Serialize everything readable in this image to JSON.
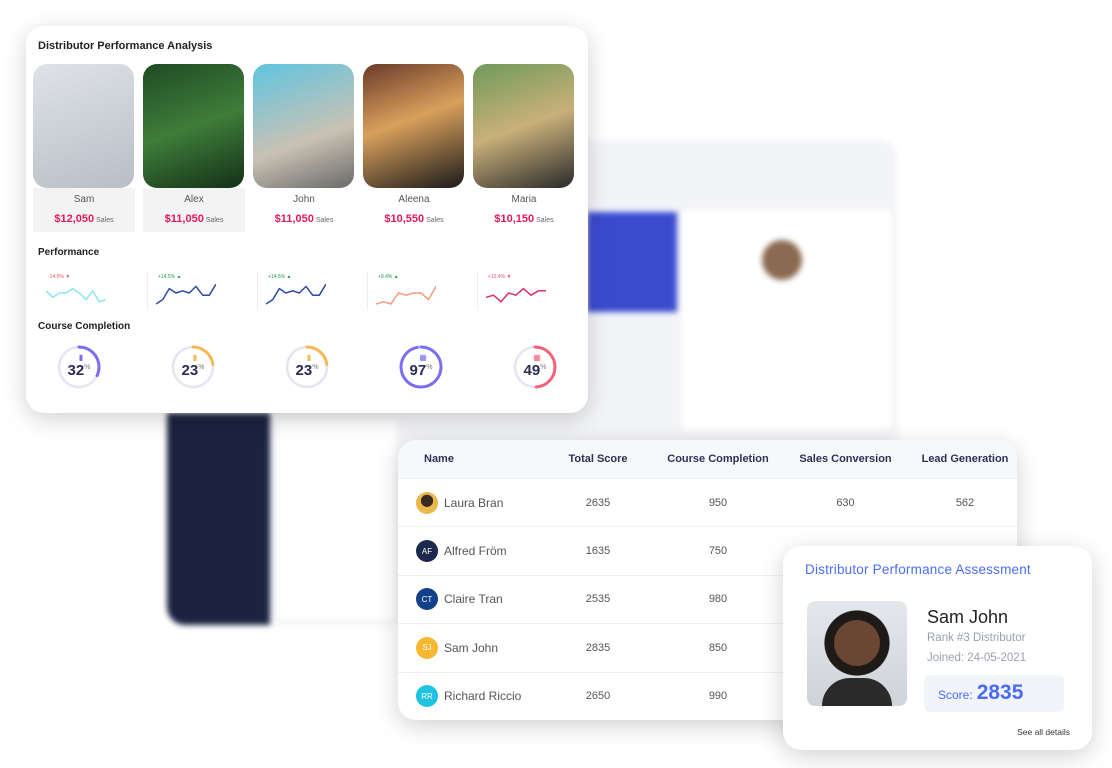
{
  "analysis": {
    "title": "Distributor Performance Analysis",
    "people": [
      {
        "name": "Sam",
        "sales": "$12,050",
        "unit": "Sales",
        "photo": "linear-gradient(160deg,#dfe3e8,#b8bec6)"
      },
      {
        "name": "Alex",
        "sales": "$11,050",
        "unit": "Sales",
        "photo": "linear-gradient(160deg,#1f4a24,#3f7d3a 50%,#143018)"
      },
      {
        "name": "John",
        "sales": "$11,050",
        "unit": "Sales",
        "photo": "linear-gradient(160deg,#5fc4e0,#c9c2b4 60%,#6a6a6a)"
      },
      {
        "name": "Aleena",
        "sales": "$10,550",
        "unit": "Sales",
        "photo": "linear-gradient(160deg,#6a3a2a,#d9a05c 45%,#1a1a1a)"
      },
      {
        "name": "Maria",
        "sales": "$10,150",
        "unit": "Sales",
        "photo": "linear-gradient(160deg,#6f9a5a,#c9b07a 50%,#2a2a2a)"
      }
    ],
    "performance_title": "Performance",
    "sparklines": [
      {
        "label": "-14.5% ▼",
        "label_color": "#e0556a",
        "color": "#8be3f0",
        "shape": [
          6,
          3,
          5,
          5,
          7,
          5,
          2,
          6,
          1,
          2
        ]
      },
      {
        "label": "+14.5% ▲",
        "label_color": "#1a9a4a",
        "color": "#2b4aa8",
        "shape": [
          0,
          2,
          7,
          5,
          6,
          5,
          8,
          4,
          4,
          9
        ]
      },
      {
        "label": "+14.5% ▲",
        "label_color": "#1a9a4a",
        "color": "#2b4aa8",
        "shape": [
          0,
          2,
          7,
          5,
          6,
          5,
          8,
          4,
          4,
          9
        ]
      },
      {
        "label": "+9.4% ▲",
        "label_color": "#1a9a4a",
        "color": "#f49a7a",
        "shape": [
          0,
          1,
          0,
          5,
          4,
          5,
          5,
          2,
          8
        ]
      },
      {
        "label": "+12.4% ▼",
        "label_color": "#e0556a",
        "color": "#d8306e",
        "shape": [
          3,
          4,
          1,
          5,
          4,
          7,
          4,
          6,
          6
        ]
      }
    ],
    "course_title": "Course Completion",
    "rings": [
      {
        "value": 32,
        "icon": "bar-chart-icon",
        "color": "#7b6cf6"
      },
      {
        "value": 23,
        "icon": "bar-chart-icon",
        "color": "#f8b756"
      },
      {
        "value": 23,
        "icon": "bar-chart-icon",
        "color": "#f8b756"
      },
      {
        "value": 97,
        "icon": "calendar-icon",
        "color": "#7b6cf6"
      },
      {
        "value": 49,
        "icon": "calendar-icon",
        "color": "#f2627a"
      }
    ],
    "percent_sign": "%"
  },
  "table": {
    "headers": [
      "Name",
      "Total Score",
      "Course Completion",
      "Sales Conversion",
      "Lead Generation"
    ],
    "rows": [
      {
        "initials": "",
        "avatar_color": "#e9b949",
        "name": "Laura Bran",
        "total": "2635",
        "course": "950",
        "sales": "630",
        "lead": "562"
      },
      {
        "initials": "AF",
        "avatar_color": "#1d2a4f",
        "name": "Alfred Fröm",
        "total": "1635",
        "course": "750",
        "sales": "",
        "lead": ""
      },
      {
        "initials": "CT",
        "avatar_color": "#12408a",
        "name": "Claire Tran",
        "total": "2535",
        "course": "980",
        "sales": "",
        "lead": ""
      },
      {
        "initials": "SJ",
        "avatar_color": "#f7b731",
        "name": "Sam John",
        "total": "2835",
        "course": "850",
        "sales": "",
        "lead": ""
      },
      {
        "initials": "RR",
        "avatar_color": "#1ec3e0",
        "name": "Richard Riccio",
        "total": "2650",
        "course": "990",
        "sales": "",
        "lead": ""
      }
    ]
  },
  "assessment": {
    "title": "Distributor Performance Assessment",
    "name": "Sam John",
    "rank": "Rank #3 Distributor",
    "joined": "Joined: 24-05-2021",
    "score_label": "Score:",
    "score": "2835",
    "link": "See all details"
  }
}
